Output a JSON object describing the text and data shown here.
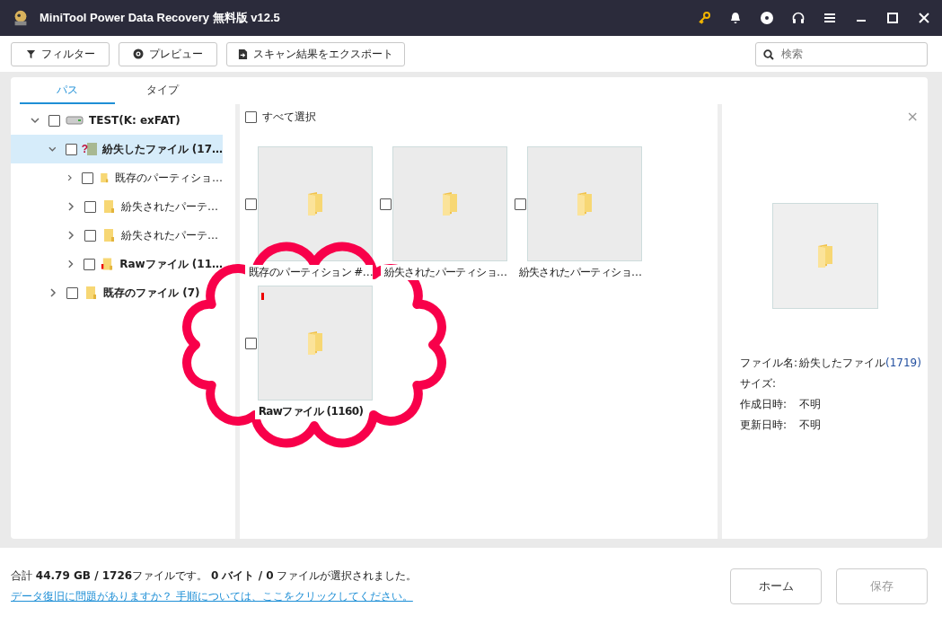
{
  "window": {
    "title": "MiniTool Power Data Recovery 無料版 v12.5"
  },
  "toolbar": {
    "buttons": [
      {
        "label": "フィルター",
        "kind": "filter"
      },
      {
        "label": "プレビュー",
        "kind": "preview"
      },
      {
        "label": "スキャン結果をエクスポート",
        "kind": "export"
      }
    ],
    "search": {
      "placeholder": "検索"
    }
  },
  "tabs": [
    {
      "label": "パス",
      "selected": true
    },
    {
      "label": "タイプ",
      "selected": false
    }
  ],
  "tree": [
    {
      "label": "TEST(K: exFAT)",
      "kind": "drive",
      "bold": true,
      "expanded": true,
      "checked": false,
      "selected": false,
      "children": [
        {
          "label": "紛失したファイル (17…",
          "kind": "lost",
          "badge": "?",
          "bold": true,
          "expanded": true,
          "checked": false,
          "selected": true,
          "children": [
            {
              "label": "既存のパーティショ…",
              "kind": "folder",
              "bold": false,
              "expanded": false,
              "checked": false,
              "selected": false
            },
            {
              "label": "紛失されたパーテ…",
              "kind": "folder",
              "bold": false,
              "expanded": false,
              "checked": false,
              "selected": false
            },
            {
              "label": "紛失されたパーテ…",
              "kind": "folder",
              "bold": false,
              "expanded": false,
              "checked": false,
              "selected": false
            },
            {
              "label": "Rawファイル (11…",
              "kind": "raw",
              "bold": true,
              "expanded": false,
              "checked": false,
              "selected": false
            }
          ]
        },
        {
          "label": "既存のファイル (7)",
          "kind": "folder",
          "bold": true,
          "expanded": false,
          "checked": false,
          "selected": false
        }
      ]
    }
  ],
  "select_all": {
    "label": "すべて選択",
    "checked": false
  },
  "files": [
    {
      "name": "既存のパーティション #…",
      "kind": "folder",
      "bold": false,
      "checked": false
    },
    {
      "name": "紛失されたパーティショ…",
      "kind": "folder",
      "bold": false,
      "checked": false
    },
    {
      "name": "紛失されたパーティショ…",
      "kind": "folder",
      "bold": false,
      "checked": false
    },
    {
      "name": "Rawファイル (1160)",
      "kind": "raw",
      "bold": true,
      "checked": false
    }
  ],
  "preview": {
    "close": "×",
    "info": [
      {
        "label": "ファイル名:",
        "value": "紛失したファイル",
        "count": "(1719)"
      },
      {
        "label": "サイズ:"
      },
      {
        "label": "作成日時:",
        "value": "不明"
      },
      {
        "label": "更新日時:",
        "value": "不明"
      }
    ]
  },
  "status": {
    "summary": "合計 **44.79 GB / 1726**ファイルです。 **0 バイト / 0** ファイルが選択されました。",
    "help_link": "データ復旧に問題がありますか？ 手順については、ここをクリックしてください。"
  },
  "buttons": [
    {
      "label": "ホーム",
      "disabled": false
    },
    {
      "label": "保存",
      "disabled": true
    }
  ]
}
